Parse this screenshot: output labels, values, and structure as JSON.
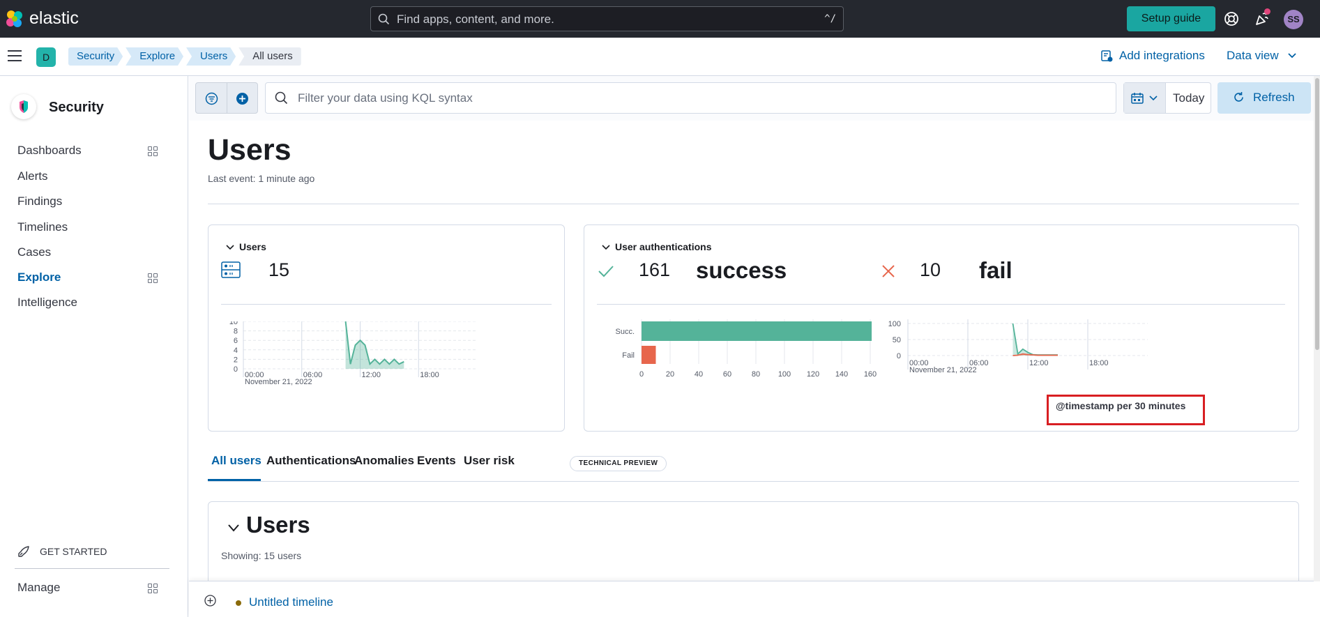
{
  "header": {
    "logo_text": "elastic",
    "search_placeholder": "Find apps, content, and more.",
    "search_shortcut": "^/",
    "setup_guide": "Setup guide",
    "avatar_initials": "SS"
  },
  "subheader": {
    "space_letter": "D",
    "breadcrumbs": [
      "Security",
      "Explore",
      "Users",
      "All users"
    ],
    "add_integrations": "Add integrations",
    "data_view": "Data view"
  },
  "sidebar": {
    "title": "Security",
    "items": [
      {
        "label": "Dashboards",
        "grid_icon": true
      },
      {
        "label": "Alerts",
        "grid_icon": false
      },
      {
        "label": "Findings",
        "grid_icon": false
      },
      {
        "label": "Timelines",
        "grid_icon": false
      },
      {
        "label": "Cases",
        "grid_icon": false
      },
      {
        "label": "Explore",
        "grid_icon": true,
        "active": true
      },
      {
        "label": "Intelligence",
        "grid_icon": false
      }
    ],
    "get_started": "GET STARTED",
    "manage": "Manage"
  },
  "querybar": {
    "kql_placeholder": "Filter your data using KQL syntax",
    "date": "Today",
    "refresh": "Refresh"
  },
  "page": {
    "title": "Users",
    "last_event": "Last event: 1 minute ago"
  },
  "users_kpi": {
    "title": "Users",
    "count": "15"
  },
  "auth_kpi": {
    "title": "User authentications",
    "success_count": "161",
    "success_label": "success",
    "fail_count": "10",
    "fail_label": "fail"
  },
  "annotation": {
    "highlight_text": "@timestamp per 30 minutes"
  },
  "tabs": {
    "items": [
      "All users",
      "Authentications",
      "Anomalies",
      "Events",
      "User risk"
    ],
    "badge": "TECHNICAL PREVIEW"
  },
  "users_table": {
    "title": "Users",
    "showing": "Showing: 15 users"
  },
  "timeline": {
    "label": "Untitled timeline"
  },
  "colors": {
    "success": "#54b399",
    "fail": "#e7664c",
    "accent": "#0061a6",
    "header_bg": "#25282f",
    "setup_btn": "#1aa6a1"
  },
  "chart_data": [
    {
      "type": "area",
      "name": "users-over-time",
      "y_ticks": [
        "0",
        "2",
        "4",
        "6",
        "8",
        "10"
      ],
      "ylim": [
        0,
        10
      ],
      "x_ticks": [
        "00:00",
        "06:00",
        "12:00",
        "18:00"
      ],
      "x_sub_label": "November 21, 2022",
      "xlim_hours": [
        0,
        24
      ],
      "x_hours": [
        10.5,
        11.0,
        11.5,
        12.0,
        12.5,
        13.0,
        13.5,
        14.0,
        14.5,
        15.0,
        15.5,
        16.0,
        16.5
      ],
      "values": [
        10,
        1,
        5,
        6,
        5,
        1,
        2,
        1,
        2,
        1,
        2,
        1,
        1.5
      ],
      "color": "#54b399"
    },
    {
      "type": "bar",
      "name": "auth-success-fail",
      "orientation": "horizontal",
      "categories": [
        "Succ.",
        "Fail"
      ],
      "values": [
        161,
        10
      ],
      "colors": [
        "#54b399",
        "#e7664c"
      ],
      "x_ticks": [
        "0",
        "20",
        "40",
        "60",
        "80",
        "100",
        "120",
        "140",
        "160"
      ],
      "xlim": [
        0,
        160
      ]
    },
    {
      "type": "line",
      "name": "auth-over-time",
      "y_ticks": [
        "0",
        "50",
        "100"
      ],
      "ylim": [
        0,
        100
      ],
      "x_ticks": [
        "00:00",
        "06:00",
        "12:00",
        "18:00"
      ],
      "x_sub_label": "November 21, 2022",
      "xlim_hours": [
        0,
        24
      ],
      "series": [
        {
          "name": "success",
          "x_hours": [
            10.5,
            11.0,
            11.5,
            12.0,
            12.5,
            13.0,
            14.0,
            15.0
          ],
          "values": [
            100,
            5,
            20,
            10,
            3,
            2,
            2,
            2
          ],
          "color": "#54b399"
        },
        {
          "name": "fail",
          "x_hours": [
            10.5,
            11.0,
            11.5,
            12.0,
            13.0,
            15.0
          ],
          "values": [
            0,
            1,
            5,
            3,
            1,
            1
          ],
          "color": "#e7664c"
        }
      ],
      "axis_title": "@timestamp per 30 minutes"
    }
  ]
}
